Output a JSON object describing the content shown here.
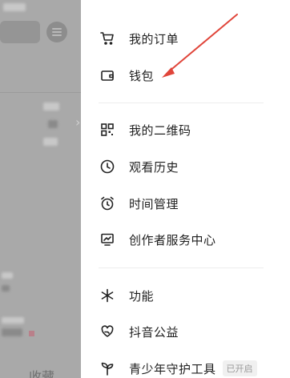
{
  "menu": {
    "orders": "我的订单",
    "wallet": "钱包",
    "qrcode": "我的二维码",
    "history": "观看历史",
    "time": "时间管理",
    "creator": "创作者服务中心",
    "features": "功能",
    "charity": "抖音公益",
    "youth": "青少年守护工具",
    "youth_badge": "已开启"
  },
  "background": {
    "collect_label": "收藏"
  },
  "colors": {
    "overlay": "#a9a9a9",
    "arrow": "#e0453a",
    "text": "#1f1f1f"
  }
}
